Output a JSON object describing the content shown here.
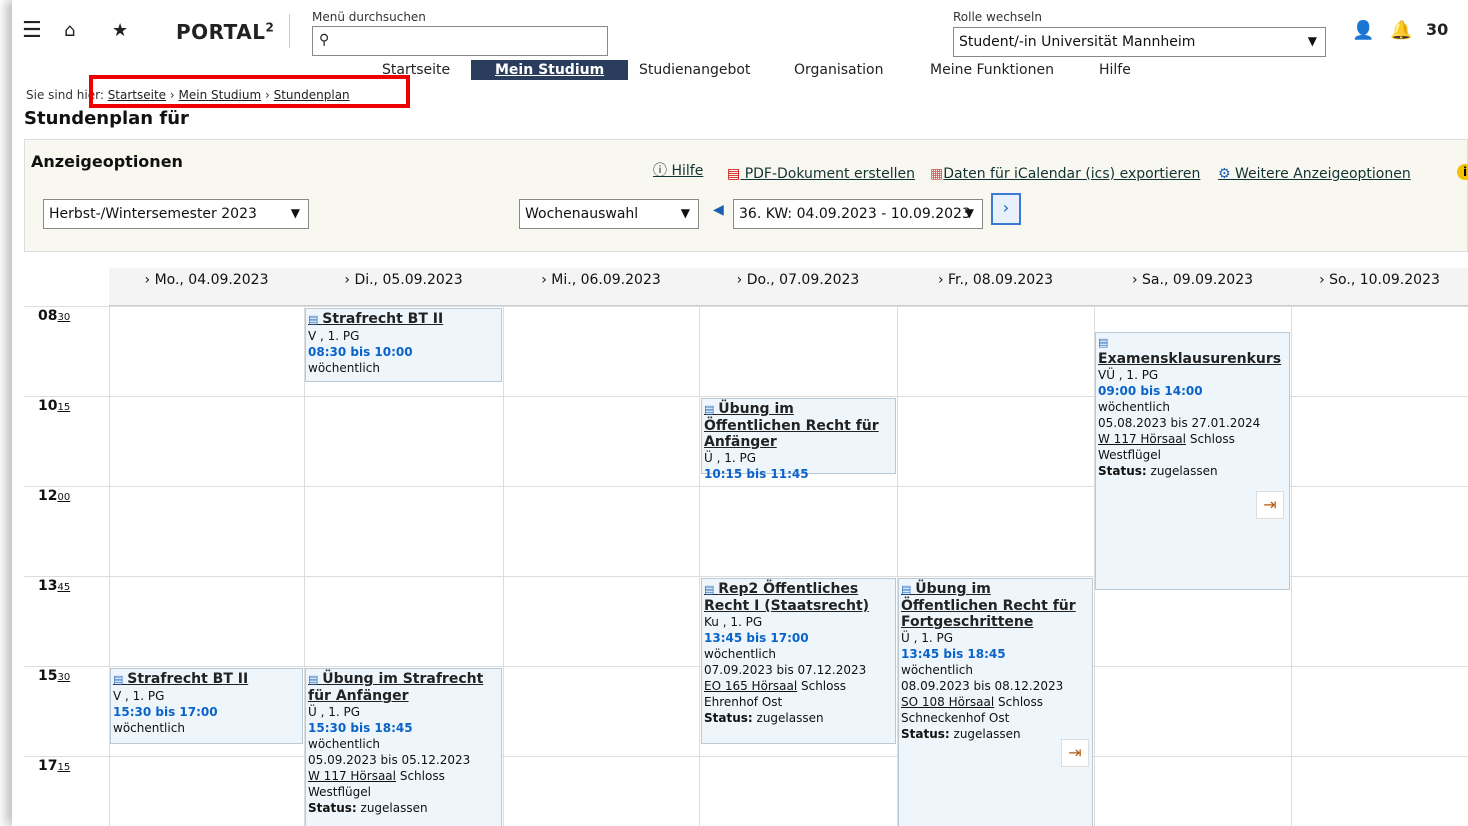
{
  "header": {
    "logo": "PORTAL",
    "logo_sup": "2",
    "search_label": "Menü durchsuchen",
    "role_label": "Rolle wechseln",
    "role_value": "Student/-in Universität Mannheim",
    "notif_count": "30",
    "nav": [
      "Startseite",
      "Mein Studium",
      "Studienangebot",
      "Organisation",
      "Meine Funktionen",
      "Hilfe"
    ]
  },
  "breadcrumb": {
    "prefix": "Sie sind hier:",
    "items": [
      "Startseite",
      "Mein Studium",
      "Stundenplan"
    ]
  },
  "page_title": "Stundenplan für",
  "options": {
    "heading": "Anzeigeoptionen",
    "help": "Hilfe",
    "pdf": "PDF-Dokument erstellen",
    "ical": "Daten für iCalendar (ics) exportieren",
    "more": "Weitere Anzeigeoptionen",
    "semester": "Herbst-/Wintersemester 2023",
    "week_mode": "Wochenauswahl",
    "week": "36. KW: 04.09.2023 - 10.09.2023"
  },
  "days": [
    "Mo., 04.09.2023",
    "Di., 05.09.2023",
    "Mi., 06.09.2023",
    "Do., 07.09.2023",
    "Fr., 08.09.2023",
    "Sa., 09.09.2023",
    "So., 10.09.2023"
  ],
  "times": [
    {
      "h": "08",
      "m": "30"
    },
    {
      "h": "10",
      "m": "15"
    },
    {
      "h": "12",
      "m": "00"
    },
    {
      "h": "13",
      "m": "45"
    },
    {
      "h": "15",
      "m": "30"
    },
    {
      "h": "17",
      "m": "15"
    }
  ],
  "events": [
    {
      "title": "Strafrecht BT II",
      "type": "V , 1. PG",
      "time": "08:30 bis 10:00",
      "rhythm": "wöchentlich"
    },
    {
      "title": "Übung im Öffentlichen Recht für Anfänger",
      "type": "Ü , 1. PG",
      "time": "10:15 bis 11:45"
    },
    {
      "title": "Examensklausurenkurs",
      "type": "VÜ , 1. PG",
      "time": "09:00 bis 14:00",
      "rhythm": "wöchentlich",
      "range": "05.08.2023 bis 27.01.2024",
      "room": "W 117 Hörsaal",
      "place": "Schloss Westflügel",
      "status_label": "Status:",
      "status": "zugelassen"
    },
    {
      "title": "Rep2 Öffentliches Recht I (Staatsrecht)",
      "type": "Ku , 1. PG",
      "time": "13:45 bis 17:00",
      "rhythm": "wöchentlich",
      "range": "07.09.2023 bis 07.12.2023",
      "room": "EO 165 Hörsaal",
      "place": "Schloss Ehrenhof Ost",
      "status_label": "Status:",
      "status": "zugelassen"
    },
    {
      "title": "Übung im Öffentlichen Recht für Fortgeschrittene",
      "type": "Ü , 1. PG",
      "time": "13:45 bis 18:45",
      "rhythm": "wöchentlich",
      "range": "08.09.2023 bis 08.12.2023",
      "room": "SO 108 Hörsaal",
      "place": "Schloss Schneckenhof Ost",
      "status_label": "Status:",
      "status": "zugelassen"
    },
    {
      "title": "Strafrecht BT II",
      "type": "V , 1. PG",
      "time": "15:30 bis 17:00",
      "rhythm": "wöchentlich"
    },
    {
      "title": "Übung im Strafrecht für Anfänger",
      "type": "Ü , 1. PG",
      "time": "15:30 bis 18:45",
      "rhythm": "wöchentlich",
      "range": "05.09.2023 bis 05.12.2023",
      "room": "W 117 Hörsaal",
      "place": "Schloss Westflügel",
      "status_label": "Status:",
      "status": "zugelassen"
    }
  ]
}
